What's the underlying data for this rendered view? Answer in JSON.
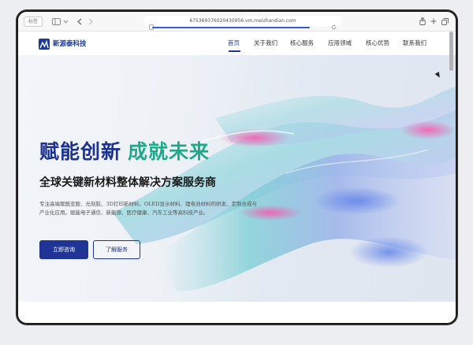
{
  "browser": {
    "tab_label": "标签",
    "url": "675369376020430956.vm.meizhandian.com"
  },
  "site": {
    "logo_text": "新源泰科技",
    "nav": [
      {
        "label": "首页",
        "active": true
      },
      {
        "label": "关于我们",
        "active": false
      },
      {
        "label": "核心服务",
        "active": false
      },
      {
        "label": "应用领域",
        "active": false
      },
      {
        "label": "核心优势",
        "active": false
      },
      {
        "label": "联系我们",
        "active": false
      }
    ]
  },
  "hero": {
    "title_part1": "赋能创新",
    "title_part2": "成就未来",
    "subtitle": "全球关键新材料整体解决方案服务商",
    "description": "专注高端聚酰亚胺、光刻胶、3D打印新材料、OLED显示材料、锂电池材料的研发、定制合成与产业化应用。赋能电子通信、新能源、医疗健康、汽车工业等高科技产业。",
    "primary_button": "立即咨询",
    "secondary_button": "了解服务"
  },
  "colors": {
    "brand_blue": "#1f3494",
    "accent_green": "#1fa98a"
  }
}
